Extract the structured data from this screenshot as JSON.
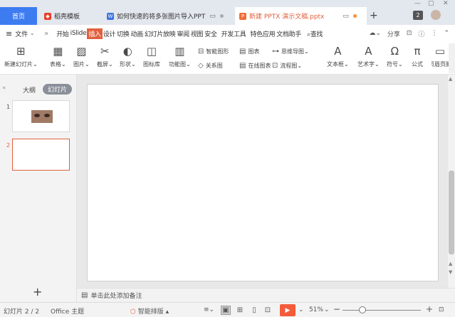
{
  "tabs": {
    "home": "首页",
    "items": [
      {
        "label": "稻壳模板",
        "icon_color": "#e8402a",
        "icon_glyph": "◆"
      },
      {
        "label": "如何快速的将多张图片导入PPT",
        "icon_color": "#3b73e0",
        "icon_glyph": "W"
      },
      {
        "label": "新建 PPTX 演示文稿.pptx",
        "icon_color": "#ef6c35",
        "icon_glyph": "P"
      }
    ],
    "add": "+",
    "window_count": "2"
  },
  "menu": {
    "file_label": "文件",
    "items": [
      "开始",
      "iSlide",
      "插入",
      "设计",
      "切换",
      "动画",
      "幻灯片放映",
      "审阅",
      "视图",
      "安全",
      "开发工具",
      "特色应用",
      "文档助手"
    ],
    "active_item": "插入",
    "search": "查找",
    "share": "分享"
  },
  "ribbon": {
    "new_slide": "新建幻灯片",
    "table": "表格",
    "picture": "图片",
    "screenshot": "截屏",
    "shape": "形状",
    "icon_lib": "图标库",
    "function_chart": "功能图",
    "smart_graphic": "智能图形",
    "chart": "图表",
    "mindmap": "思维导图",
    "relation": "关系图",
    "online_chart": "在线图表",
    "flowchart": "流程图",
    "textbox": "文本框",
    "wordart": "艺术字",
    "symbol": "符号",
    "formula": "公式",
    "header_footer": "页眉页脚"
  },
  "left_panel": {
    "outline": "大纲",
    "slides": "幻灯片",
    "slide_numbers": [
      "1",
      "2"
    ],
    "add": "+"
  },
  "notes": {
    "placeholder": "单击此处添加备注"
  },
  "status": {
    "slide_info": "幻灯片 2 / 2",
    "theme": "Office 主题",
    "smart_layout": "智能排版",
    "zoom": "51%"
  },
  "colors": {
    "accent": "#e25f3c",
    "tab_home": "#3d7cf0",
    "play": "#f35b3b"
  }
}
